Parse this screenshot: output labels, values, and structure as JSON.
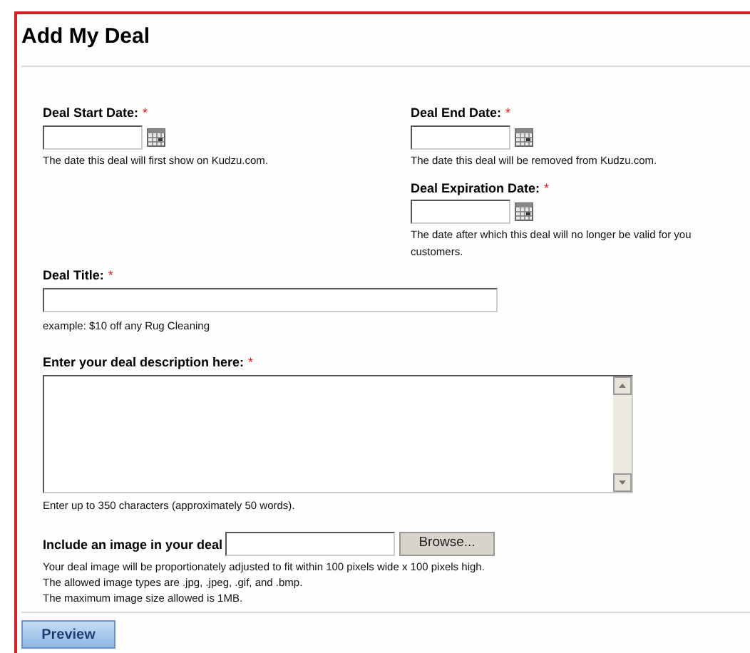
{
  "title": "Add My Deal",
  "start_date": {
    "label": "Deal Start Date:",
    "required_mark": "*",
    "hint": "The date this deal will first show on Kudzu.com."
  },
  "end_date": {
    "label": "Deal End Date:",
    "required_mark": "*",
    "hint": "The date this deal will be removed from Kudzu.com."
  },
  "expiration_date": {
    "label": "Deal Expiration Date:",
    "required_mark": "*",
    "hint_lines": [
      "The date after which this deal will no longer be valid for you",
      "customers."
    ]
  },
  "deal_title": {
    "label": "Deal Title:",
    "required_mark": "*",
    "hint": "example: $10 off any Rug Cleaning"
  },
  "description": {
    "label": "Enter your deal description here:",
    "required_mark": "*",
    "hint": "Enter up to 350 characters (approximately 50 words)."
  },
  "image": {
    "label": "Include an image in your deal",
    "browse_button": "Browse...",
    "notes": [
      "Your deal image will be proportionately adjusted to fit within 100 pixels wide x 100 pixels high.",
      "The allowed image types are .jpg, .jpeg, .gif, and .bmp.",
      "The maximum image size allowed is 1MB."
    ]
  },
  "preview_button": "Preview"
}
